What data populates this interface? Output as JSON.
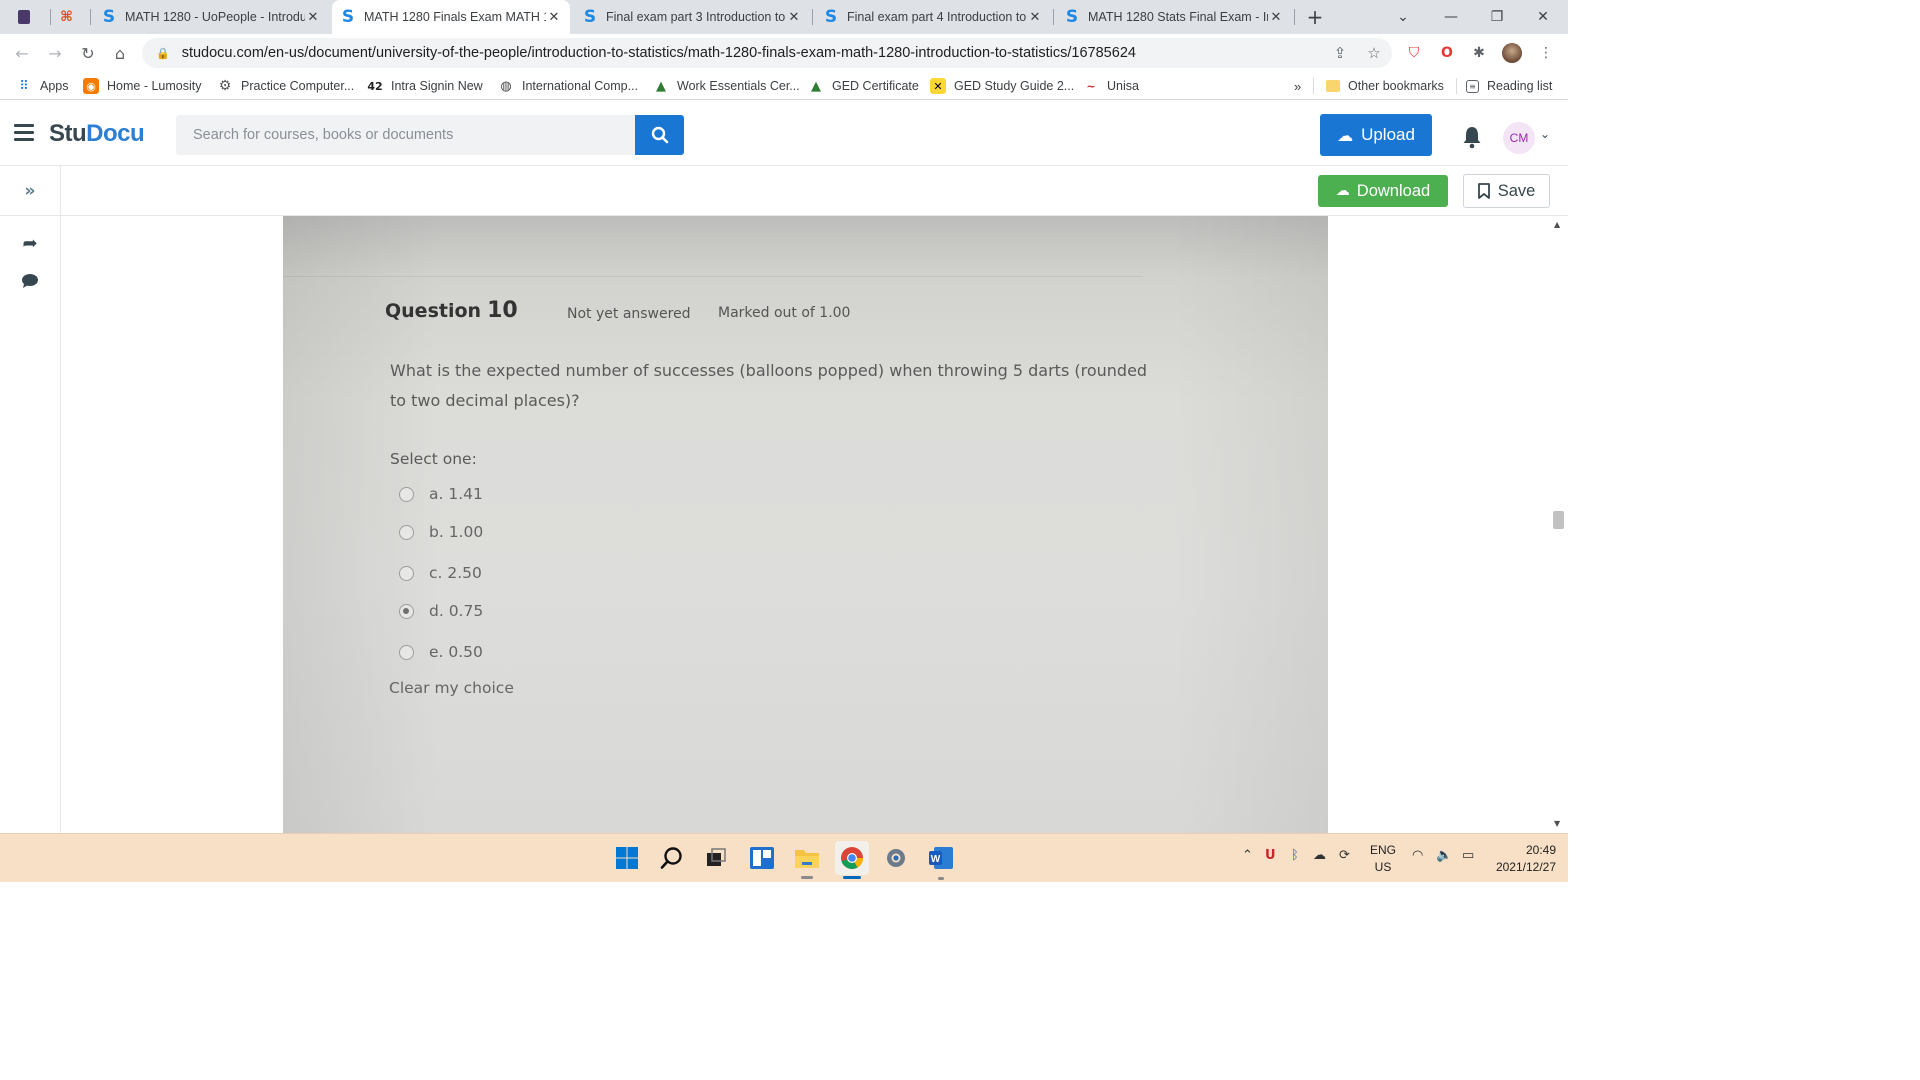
{
  "browser": {
    "tabs": [
      {
        "title": "MATH 1280 - UoPeople - Introdu",
        "active": false
      },
      {
        "title": "MATH 1280 Finals Exam MATH 1",
        "active": true
      },
      {
        "title": "Final exam part 3 Introduction to",
        "active": false
      },
      {
        "title": "Final exam part 4 Introduction to",
        "active": false
      },
      {
        "title": "MATH 1280 Stats Final Exam - In",
        "active": false
      }
    ],
    "url": "studocu.com/en-us/document/university-of-the-people/introduction-to-statistics/math-1280-finals-exam-math-1280-introduction-to-statistics/16785624",
    "bookmarks": [
      {
        "label": "Apps",
        "icon": "apps-grid-icon"
      },
      {
        "label": "Home - Lumosity",
        "icon": "lumosity-icon"
      },
      {
        "label": "Practice Computer...",
        "icon": "practice-icon"
      },
      {
        "label": "Intra Signin New",
        "icon": "intra-icon"
      },
      {
        "label": "International Comp...",
        "icon": "globe-icon"
      },
      {
        "label": "Work Essentials Cer...",
        "icon": "grad-cap-icon"
      },
      {
        "label": "GED Certificate",
        "icon": "grad-cap-icon"
      },
      {
        "label": "GED Study Guide 2...",
        "icon": "x-icon"
      },
      {
        "label": "Unisa",
        "icon": "unisa-icon"
      }
    ],
    "bookmarks_overflow": "»",
    "other_bookmarks": "Other bookmarks",
    "reading_list": "Reading list"
  },
  "studocu": {
    "logo_stu": "Stu",
    "logo_docu": "Docu",
    "search_placeholder": "Search for courses, books or documents",
    "upload_label": "Upload",
    "avatar_initials": "CM",
    "download_label": "Download",
    "save_label": "Save",
    "brand_blue": "#1976d2",
    "download_green": "#4caf50"
  },
  "question": {
    "title": "Question",
    "number": "10",
    "status": "Not yet answered",
    "marked": "Marked out of 1.00",
    "text": "What is the expected number of successes (balloons popped) when throwing 5 darts (rounded to two decimal places)?",
    "select_one": "Select one:",
    "options": [
      {
        "label": "a. 1.41",
        "checked": false
      },
      {
        "label": "b. 1.00",
        "checked": false
      },
      {
        "label": "c. 2.50",
        "checked": false
      },
      {
        "label": "d. 0.75",
        "checked": true
      },
      {
        "label": "e. 0.50",
        "checked": false
      }
    ],
    "clear_choice": "Clear my choice"
  },
  "taskbar": {
    "apps": [
      "windows-start-icon",
      "search-icon",
      "task-view-icon",
      "widgets-icon",
      "file-explorer-icon",
      "chrome-icon",
      "settings-icon",
      "word-icon"
    ],
    "lang_line1": "ENG",
    "lang_line2": "US",
    "time": "20:49",
    "date": "2021/12/27"
  }
}
